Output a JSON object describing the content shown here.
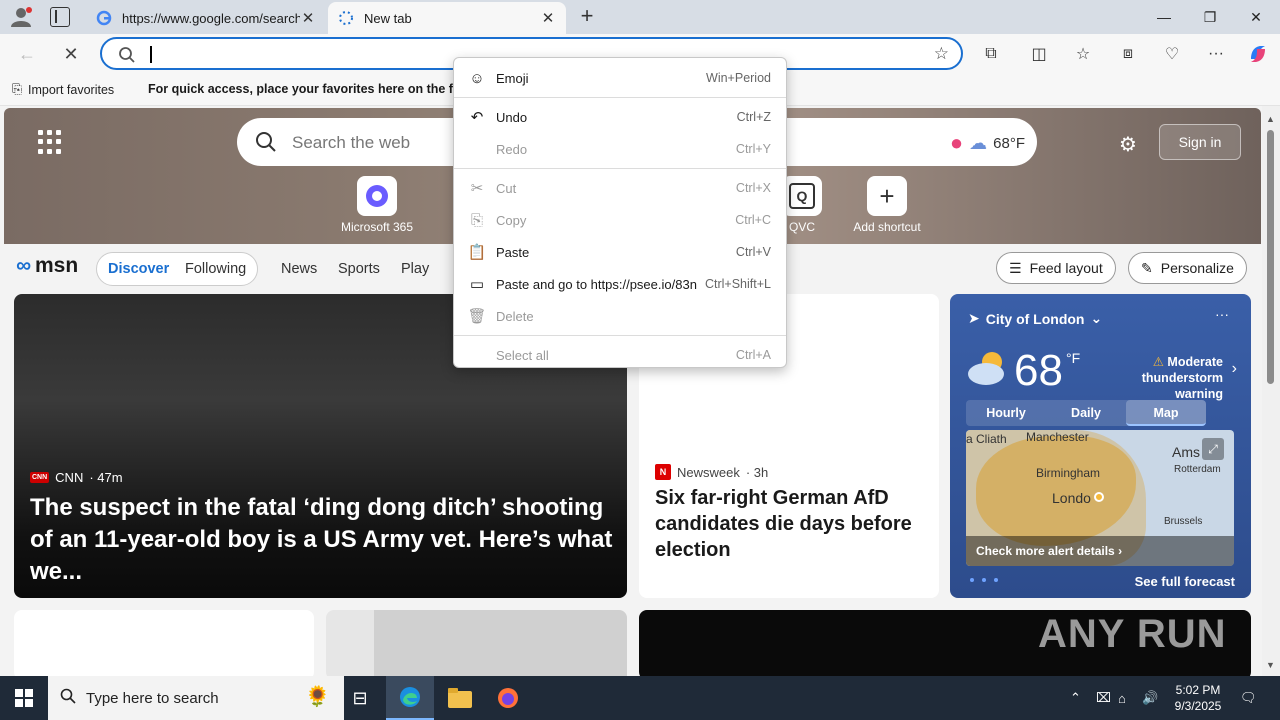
{
  "browser": {
    "tabs": [
      {
        "title": "https://www.google.com/search?q",
        "state": "inactive"
      },
      {
        "title": "New tab",
        "state": "active"
      }
    ],
    "address_value": "",
    "favorites_bar": {
      "import_label": "Import favorites",
      "hint": "For quick access, place your favorites here on the favorites bar."
    }
  },
  "newtab": {
    "search_placeholder": "Search the web",
    "weather_temp": "68°F",
    "signin_label": "Sign in",
    "shortcuts": [
      {
        "label": "Microsoft 365",
        "icon": "microsoft-365-icon"
      },
      {
        "label": "QVC",
        "icon": "qvc-icon"
      },
      {
        "label": "Add shortcut",
        "icon": "plus-icon"
      }
    ]
  },
  "msn": {
    "logo": "msn",
    "tabs": [
      "Discover",
      "Following"
    ],
    "nav": [
      "News",
      "Sports",
      "Play"
    ],
    "feed_layout_label": "Feed layout",
    "personalize_label": "Personalize"
  },
  "cards": {
    "main": {
      "source": "CNN",
      "source_logo": "CNN",
      "age": "· 47m",
      "headline": "The suspect in the fatal ‘ding dong ditch’ shooting of an 11-year-old boy is a US Army vet. Here’s what we..."
    },
    "mid": {
      "source": "Newsweek",
      "source_logo": "N",
      "age": "· 3h",
      "headline": "Six far-right German AfD candidates die days before election"
    }
  },
  "weather": {
    "location": "City of London",
    "temp": "68",
    "unit": "°F",
    "alert": "Moderate thunderstorm warning",
    "tabs": [
      "Hourly",
      "Daily",
      "Map"
    ],
    "active_tab": "Map",
    "map_labels": {
      "a": "a Cliath",
      "b": "Manchester",
      "c": "Birmingham",
      "d": "Londo",
      "e": "Ams",
      "f": "Rotterdam",
      "g": "Brussels"
    },
    "alert_link": "Check more alert details",
    "full_forecast": "See full forecast"
  },
  "context_menu": {
    "items": [
      {
        "label": "Emoji",
        "shortcut": "Win+Period",
        "icon": "emoji-icon",
        "enabled": true
      },
      {
        "label": "Undo",
        "shortcut": "Ctrl+Z",
        "icon": "undo-icon",
        "enabled": true
      },
      {
        "label": "Redo",
        "shortcut": "Ctrl+Y",
        "icon": "",
        "enabled": false
      },
      {
        "label": "Cut",
        "shortcut": "Ctrl+X",
        "icon": "cut-icon",
        "enabled": false
      },
      {
        "label": "Copy",
        "shortcut": "Ctrl+C",
        "icon": "copy-icon",
        "enabled": false
      },
      {
        "label": "Paste",
        "shortcut": "Ctrl+V",
        "icon": "paste-icon",
        "enabled": true
      },
      {
        "label": "Paste and go to https://psee.io/83n",
        "shortcut": "Ctrl+Shift+L",
        "icon": "paste-go-icon",
        "enabled": true
      },
      {
        "label": "Delete",
        "shortcut": "",
        "icon": "delete-icon",
        "enabled": false
      },
      {
        "label": "Select all",
        "shortcut": "Ctrl+A",
        "icon": "",
        "enabled": false
      }
    ]
  },
  "taskbar": {
    "search_placeholder": "Type here to search",
    "time": "5:02 PM",
    "date": "9/3/2025"
  },
  "watermark": "ANY RUN",
  "colors": {
    "accent": "#1a6fd0",
    "taskbar": "#1f2a38",
    "weather_bg": "#2d4c8c"
  }
}
